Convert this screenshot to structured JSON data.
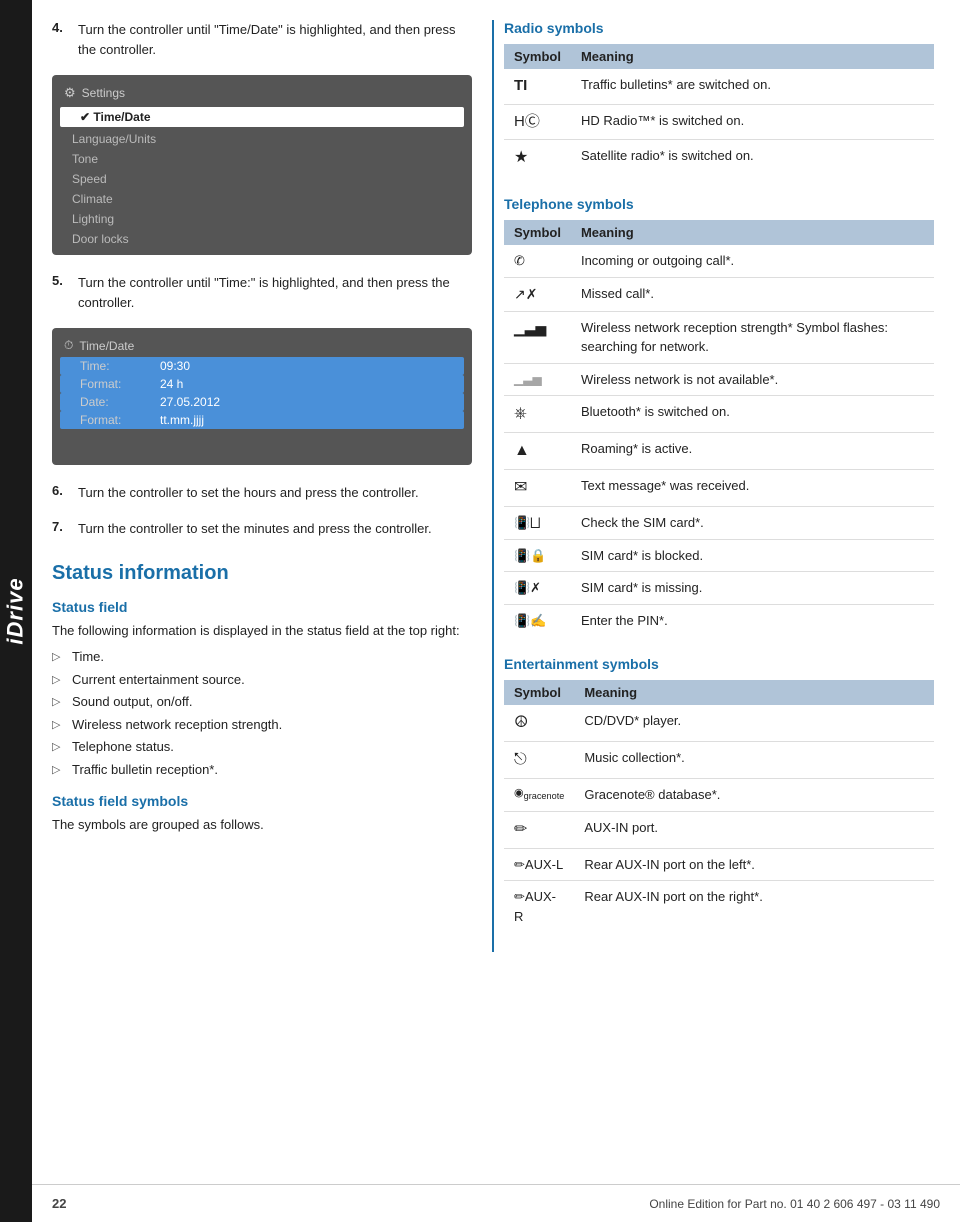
{
  "idrive": {
    "label": "iDrive"
  },
  "left": {
    "step4": {
      "number": "4.",
      "text": "Turn the controller until \"Time/Date\" is highlighted, and then press the controller."
    },
    "step5": {
      "number": "5.",
      "text": "Turn the controller until \"Time:\" is highlighted, and then press the controller."
    },
    "step6": {
      "number": "6.",
      "text": "Turn the controller to set the hours and press the controller."
    },
    "step7": {
      "number": "7.",
      "text": "Turn the controller to set the minutes and press the controller."
    },
    "screenshot1": {
      "title": "Settings",
      "items": [
        {
          "label": "Time/Date",
          "selected": true
        },
        {
          "label": "Language/Units",
          "selected": false
        },
        {
          "label": "Tone",
          "selected": false
        },
        {
          "label": "Speed",
          "selected": false
        },
        {
          "label": "Climate",
          "selected": false
        },
        {
          "label": "Lighting",
          "selected": false
        },
        {
          "label": "Door locks",
          "selected": false
        }
      ]
    },
    "screenshot2": {
      "title": "Time/Date",
      "rows": [
        {
          "label": "Time:",
          "value": "09:30",
          "highlighted": true
        },
        {
          "label": "Format:",
          "value": "24 h",
          "highlighted": true
        },
        {
          "label": "Date:",
          "value": "27.05.2012",
          "highlighted": true
        },
        {
          "label": "Format:",
          "value": "tt.mm.jjjj",
          "highlighted": true
        }
      ]
    },
    "section_heading": "Status information",
    "status_field_heading": "Status field",
    "status_field_text": "The following information is displayed in the status field at the top right:",
    "status_field_items": [
      "Time.",
      "Current entertainment source.",
      "Sound output, on/off.",
      "Wireless network reception strength.",
      "Telephone status.",
      "Traffic bulletin reception*."
    ],
    "status_field_symbols_heading": "Status field symbols",
    "status_field_symbols_text": "The symbols are grouped as follows."
  },
  "right": {
    "radio_heading": "Radio symbols",
    "radio_table": {
      "col1": "Symbol",
      "col2": "Meaning",
      "rows": [
        {
          "symbol": "TI",
          "meaning": "Traffic bulletins* are switched on.",
          "sym_style": "font-weight:bold;font-size:15px;"
        },
        {
          "symbol": "H)",
          "meaning": "HD Radio™* is switched on.",
          "sym_style": "font-size:15px;"
        },
        {
          "symbol": "★",
          "meaning": "Satellite radio* is switched on.",
          "sym_style": "font-size:16px;"
        }
      ]
    },
    "telephone_heading": "Telephone symbols",
    "telephone_table": {
      "col1": "Symbol",
      "col2": "Meaning",
      "rows": [
        {
          "symbol": "☎",
          "meaning": "Incoming or outgoing call*."
        },
        {
          "symbol": "↗",
          "meaning": "Missed call*."
        },
        {
          "symbol": "▌▌▌",
          "meaning": "Wireless network reception strength* Symbol flashes: searching for network."
        },
        {
          "symbol": "▌▌▌",
          "meaning": "Wireless network is not available*."
        },
        {
          "symbol": "⑧",
          "meaning": "Bluetooth* is switched on."
        },
        {
          "symbol": "▲",
          "meaning": "Roaming* is active."
        },
        {
          "symbol": "✉",
          "meaning": "Text message* was received."
        },
        {
          "symbol": "🖳",
          "meaning": "Check the SIM card*."
        },
        {
          "symbol": "🔒",
          "meaning": "SIM card* is blocked."
        },
        {
          "symbol": "🚫",
          "meaning": "SIM card* is missing."
        },
        {
          "symbol": "🔢",
          "meaning": "Enter the PIN*."
        }
      ]
    },
    "entertainment_heading": "Entertainment symbols",
    "entertainment_table": {
      "col1": "Symbol",
      "col2": "Meaning",
      "rows": [
        {
          "symbol": "⊙",
          "meaning": "CD/DVD* player."
        },
        {
          "symbol": "⏏",
          "meaning": "Music collection*."
        },
        {
          "symbol": "g",
          "meaning": "Gracenote® database*."
        },
        {
          "symbol": "✏",
          "meaning": "AUX-IN port."
        },
        {
          "symbol": "✏AUX-L",
          "meaning": "Rear AUX-IN port on the left*."
        },
        {
          "symbol": "✏AUX-R",
          "meaning": "Rear AUX-IN port on the right*."
        }
      ]
    }
  },
  "footer": {
    "page": "22",
    "text": "Online Edition for Part no. 01 40 2 606 497 - 03 11 490"
  }
}
